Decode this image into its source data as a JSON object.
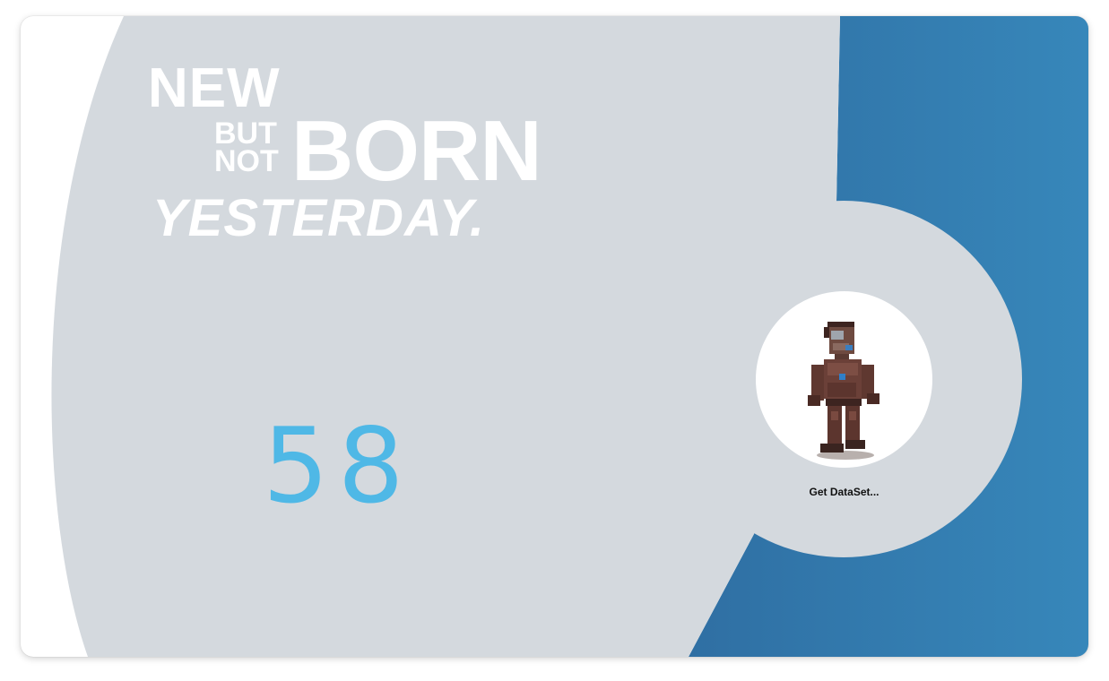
{
  "headline": {
    "line1": "NEW",
    "small_top": "BUT",
    "small_bottom": "NOT",
    "big": "BORN",
    "line3": "YESTERDAY."
  },
  "counter": {
    "value": "58"
  },
  "status": {
    "label": "Get DataSet..."
  },
  "avatar": {
    "icon": "pixel-character-sprite"
  },
  "colors": {
    "panel_gray": "#d4d9de",
    "accent_blue": "#3480b3",
    "counter_blue": "#4fb8e6",
    "text_white": "#ffffff"
  }
}
